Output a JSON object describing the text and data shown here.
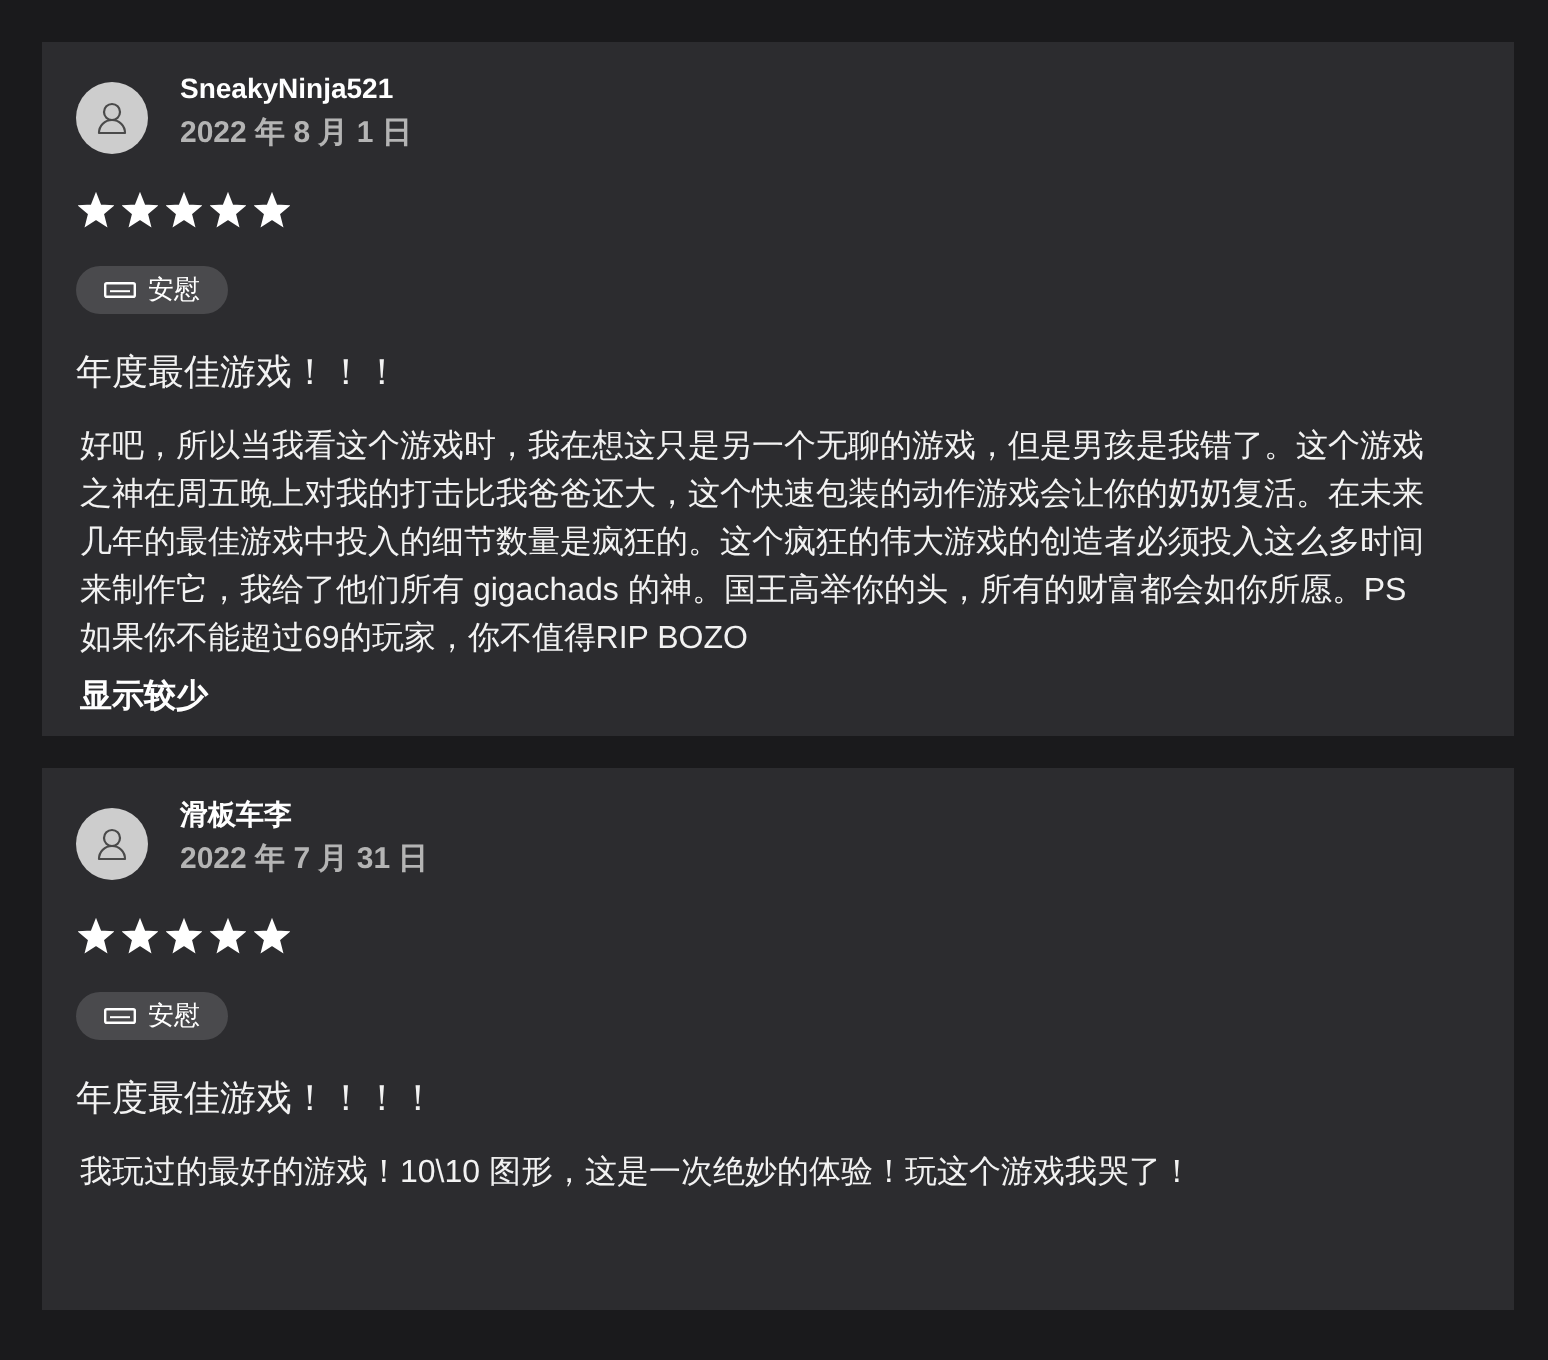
{
  "reviews": [
    {
      "author": "SneakyNinja521",
      "date": "2022 年 8 月 1 日",
      "stars": 5,
      "tag": "安慰",
      "title": "年度最佳游戏！！！",
      "body": "好吧，所以当我看这个游戏时，我在想这只是另一个无聊的游戏，但是男孩是我错了。这个游戏之神在周五晚上对我的打击比我爸爸还大，这个快速包装的动作游戏会让你的奶奶复活。在未来几年的最佳游戏中投入的细节数量是疯狂的。这个疯狂的伟大游戏的创造者必须投入这么多时间来制作它，我给了他们所有 gigachads 的神。国王高举你的头，所有的财富都会如你所愿。PS如果你不能超过69的玩家，你不值得RIP BOZO",
      "toggle_link": "显示较少"
    },
    {
      "author": "滑板车李",
      "date": "2022 年 7 月 31 日",
      "stars": 5,
      "tag": "安慰",
      "title": "年度最佳游戏！！！！",
      "body": "我玩过的最好的游戏！10\\10 图形，这是一次绝妙的体验！玩这个游戏我哭了！"
    }
  ]
}
